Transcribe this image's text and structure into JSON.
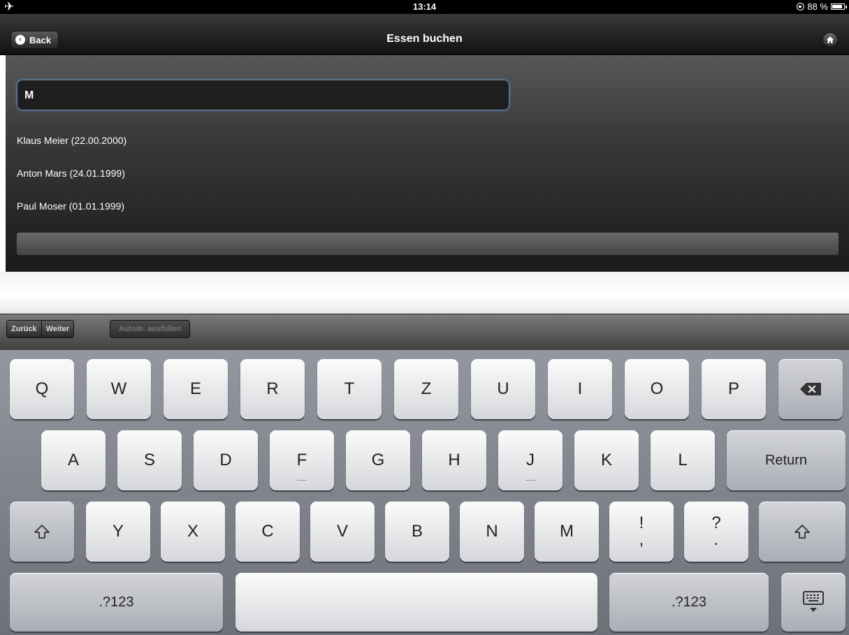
{
  "status_bar": {
    "time": "13:14",
    "battery_percent": "88 %"
  },
  "nav": {
    "back_label": "Back",
    "title": "Essen buchen"
  },
  "search": {
    "value": "M"
  },
  "results": [
    "Klaus Meier (22.00.2000)",
    "Anton Mars (24.01.1999)",
    "Paul Moser (01.01.1999)"
  ],
  "accessory": {
    "previous": "Zurück",
    "next": "Weiter",
    "autofill": "Autom. ausfüllen"
  },
  "keyboard": {
    "row1": [
      "Q",
      "W",
      "E",
      "R",
      "T",
      "Z",
      "U",
      "I",
      "O",
      "P"
    ],
    "row2": [
      "A",
      "S",
      "D",
      "F",
      "G",
      "H",
      "J",
      "K",
      "L"
    ],
    "return": "Return",
    "row3": [
      "Y",
      "X",
      "C",
      "V",
      "B",
      "N",
      "M"
    ],
    "punct1_top": "!",
    "punct1_bottom": ",",
    "punct2_top": "?",
    "punct2_bottom": ".",
    "numbers_left": ".?123",
    "numbers_right": ".?123"
  }
}
